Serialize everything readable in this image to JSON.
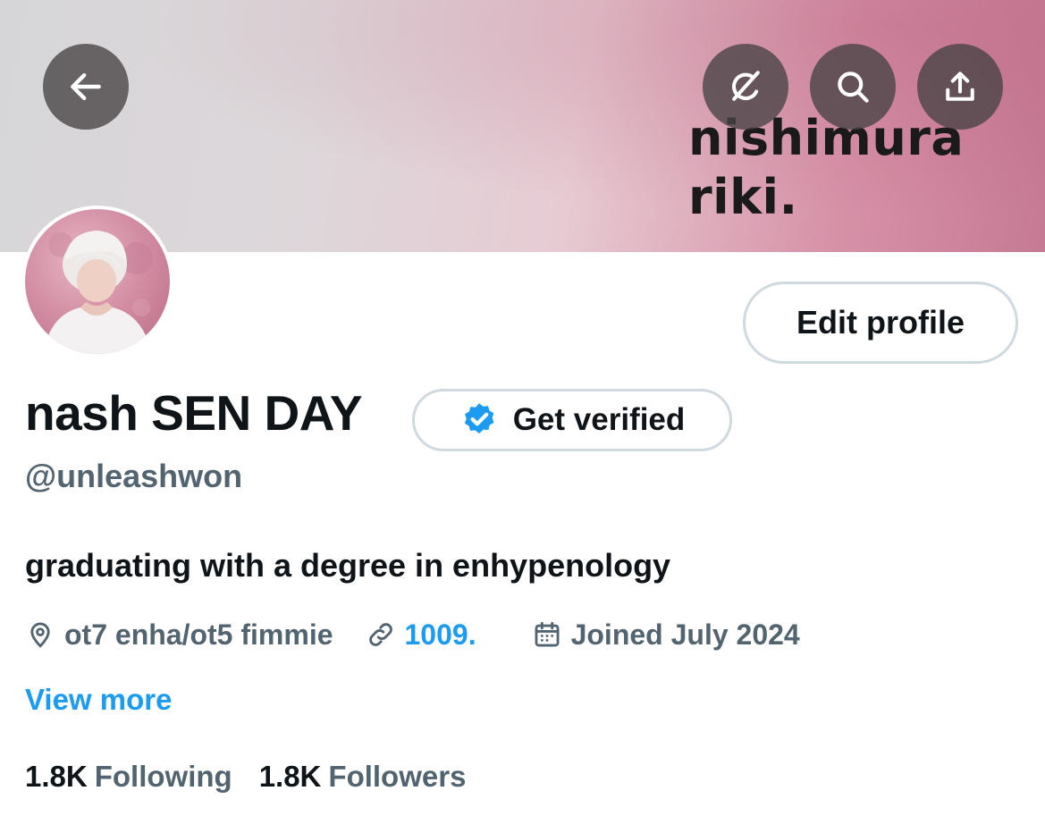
{
  "banner": {
    "text_line1": "nishimura",
    "text_line2": "riki."
  },
  "top_bar": {
    "back_icon": "arrow-left-icon",
    "grok_icon": "grok-icon",
    "search_icon": "search-icon",
    "share_icon": "share-icon"
  },
  "profile": {
    "edit_label": "Edit profile",
    "display_name": "nash SEN DAY",
    "get_verified_label": "Get verified",
    "handle": "@unleashwon",
    "bio": "graduating with a degree in enhypenology",
    "location": "ot7 enha/ot5 fimmie",
    "link": "1009.",
    "joined": "Joined July 2024",
    "view_more": "View more"
  },
  "stats": {
    "following_count": "1.8K",
    "following_label": "Following",
    "followers_count": "1.8K",
    "followers_label": "Followers"
  },
  "colors": {
    "accent": "#1d9bf0",
    "secondary_text": "#536471",
    "primary_text": "#0f1419",
    "border": "#cfd9de"
  }
}
